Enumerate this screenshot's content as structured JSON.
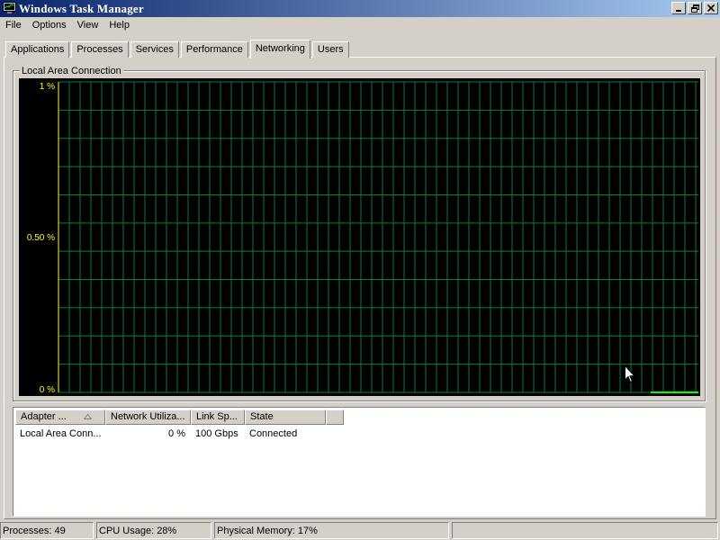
{
  "window": {
    "title": "Windows Task Manager",
    "icon": "task-manager-icon",
    "buttons": [
      "minimize-icon",
      "restore-icon",
      "close-icon"
    ]
  },
  "menu": [
    "File",
    "Options",
    "View",
    "Help"
  ],
  "tabs": [
    {
      "label": "Applications",
      "active": false
    },
    {
      "label": "Processes",
      "active": false
    },
    {
      "label": "Services",
      "active": false
    },
    {
      "label": "Performance",
      "active": false
    },
    {
      "label": "Networking",
      "active": true
    },
    {
      "label": "Users",
      "active": false
    }
  ],
  "graph": {
    "title": "Local Area Connection",
    "y_labels": {
      "top": "1 %",
      "mid": "0.50 %",
      "bottom": "0 %"
    },
    "colors": {
      "grid": "#008040",
      "axis": "#ffff00",
      "trace": "#00ff00",
      "background": "#000000"
    }
  },
  "adapter_table": {
    "columns": [
      "Adapter ...",
      "Network Utiliza...",
      "Link Sp...",
      "State"
    ],
    "sort_icon": "sort-ascending-icon",
    "rows": [
      {
        "adapter": "Local Area Conn...",
        "utilization": "0 %",
        "link_speed": "100 Gbps",
        "state": "Connected"
      }
    ]
  },
  "status": {
    "processes": "Processes: 49",
    "cpu": "CPU Usage: 28%",
    "memory": "Physical Memory: 17%"
  }
}
